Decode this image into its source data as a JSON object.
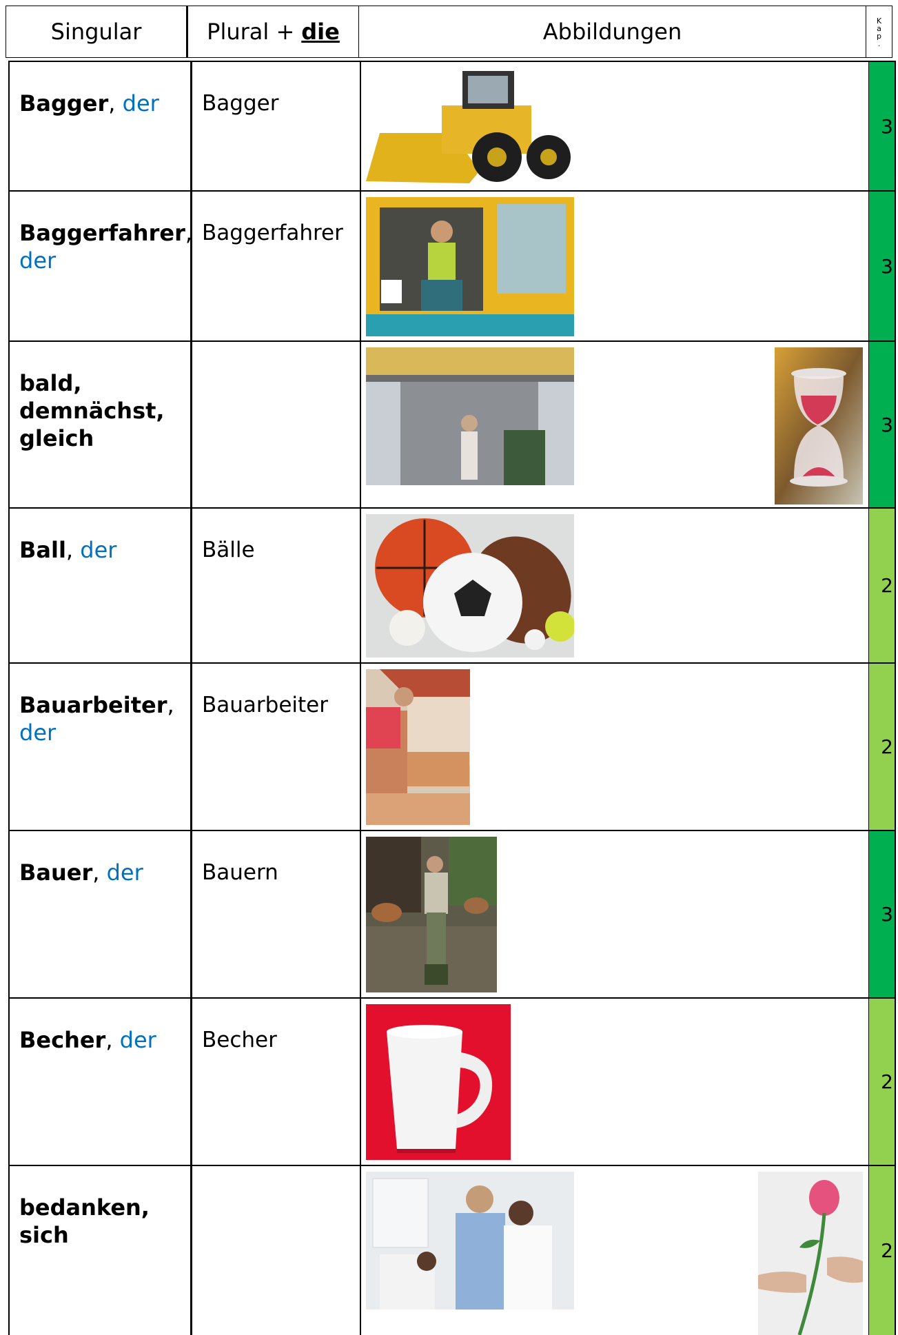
{
  "header": {
    "singular": "Singular",
    "plural": "Plural +",
    "plural_article": "die",
    "images": "Abbildungen",
    "kap": [
      "K",
      "a",
      "p",
      "."
    ]
  },
  "rows": [
    {
      "word": "Bagger",
      "sep": ",",
      "article": "der",
      "plural": "Bagger",
      "kap": "3",
      "kap_color": "#00b050"
    },
    {
      "word": "Baggerfahrer",
      "sep": ",",
      "article": "der",
      "plural": "Baggerfahrer",
      "kap": "3",
      "kap_color": "#00b050"
    },
    {
      "word": "bald, demnächst, gleich",
      "sep": "",
      "article": "",
      "plural": "",
      "kap": "3",
      "kap_color": "#00b050"
    },
    {
      "word": "Ball",
      "sep": ",",
      "article": "der",
      "plural": "Bälle",
      "kap": "2",
      "kap_color": "#92d050"
    },
    {
      "word": "Bauarbeiter",
      "sep": ",",
      "article": "der",
      "plural": "Bauarbeiter",
      "kap": "2",
      "kap_color": "#92d050"
    },
    {
      "word": "Bauer",
      "sep": ",",
      "article": "der",
      "plural": "Bauern",
      "kap": "3",
      "kap_color": "#00b050"
    },
    {
      "word": "Becher",
      "sep": ",",
      "article": "der",
      "plural": "Becher",
      "kap": "2",
      "kap_color": "#92d050"
    },
    {
      "word": "bedanken, sich",
      "sep": "",
      "article": "",
      "plural": "",
      "kap": "2",
      "kap_color": "#92d050"
    }
  ],
  "images": [
    {
      "icon": "wheel-loader-photo"
    },
    {
      "icon": "excavator-driver-photo"
    },
    {
      "icon": "woman-opening-shop-shutter-photo"
    },
    {
      "icon": "hourglass-photo"
    },
    {
      "icon": "sports-balls-photo"
    },
    {
      "icon": "construction-worker-bricks-photo"
    },
    {
      "icon": "farmer-with-cows-photo"
    },
    {
      "icon": "white-mug-photo"
    },
    {
      "icon": "patient-thanking-doctor-photo"
    },
    {
      "icon": "hand-giving-rose-photo"
    }
  ]
}
